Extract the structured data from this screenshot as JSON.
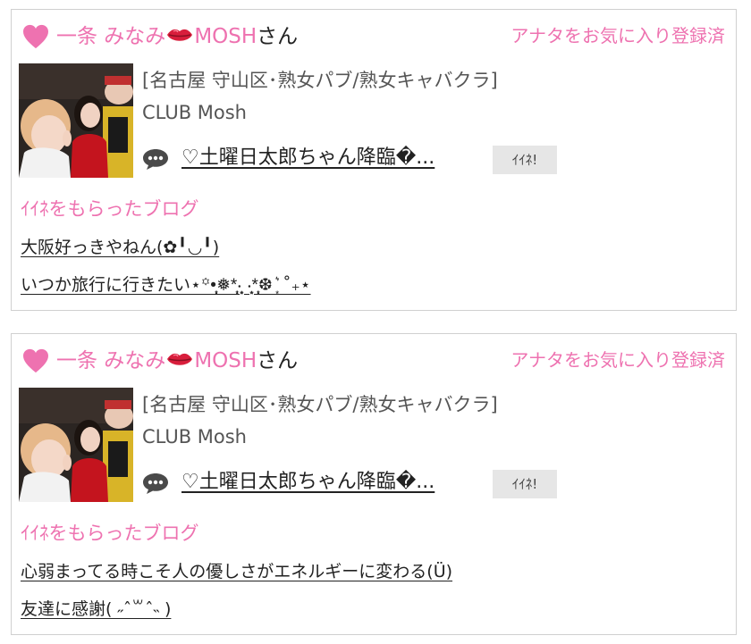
{
  "accent_color": "#ee72b0",
  "cards": [
    {
      "girl_name": "一条 みなみ",
      "girl_name_suffix": "MOSH",
      "honorific": "さん",
      "favorite_status": "アナタをお気に入り登録済",
      "shop_area": "[名古屋 守山区･熟女パブ/熟女キャバクラ]",
      "shop_name": "CLUB Mosh",
      "latest_post": "♡土曜日太郎ちゃん降臨�...",
      "iine_label": "ｲｲﾈ!",
      "liked_blogs_title": "ｲｲﾈをもらったブログ",
      "liked_blogs": [
        "大阪好っきやねん(✿╹◡╹)",
        "いつか旅行に行きたい⋆꙳•̩̩͙❅*̩̩͙‧͙ ‧͙*̩̩͙❆ ͙͛ ˚₊⋆"
      ]
    },
    {
      "girl_name": "一条 みなみ",
      "girl_name_suffix": "MOSH",
      "honorific": "さん",
      "favorite_status": "アナタをお気に入り登録済",
      "shop_area": "[名古屋 守山区･熟女パブ/熟女キャバクラ]",
      "shop_name": "CLUB Mosh",
      "latest_post": "♡土曜日太郎ちゃん降臨�...",
      "iine_label": "ｲｲﾈ!",
      "liked_blogs_title": "ｲｲﾈをもらったブログ",
      "liked_blogs": [
        "心弱まってる時こそ人の優しさがエネルギーに変わる(Ü)",
        "友達に感謝( ˶ˆ꒳ˆ˵ )"
      ]
    }
  ]
}
